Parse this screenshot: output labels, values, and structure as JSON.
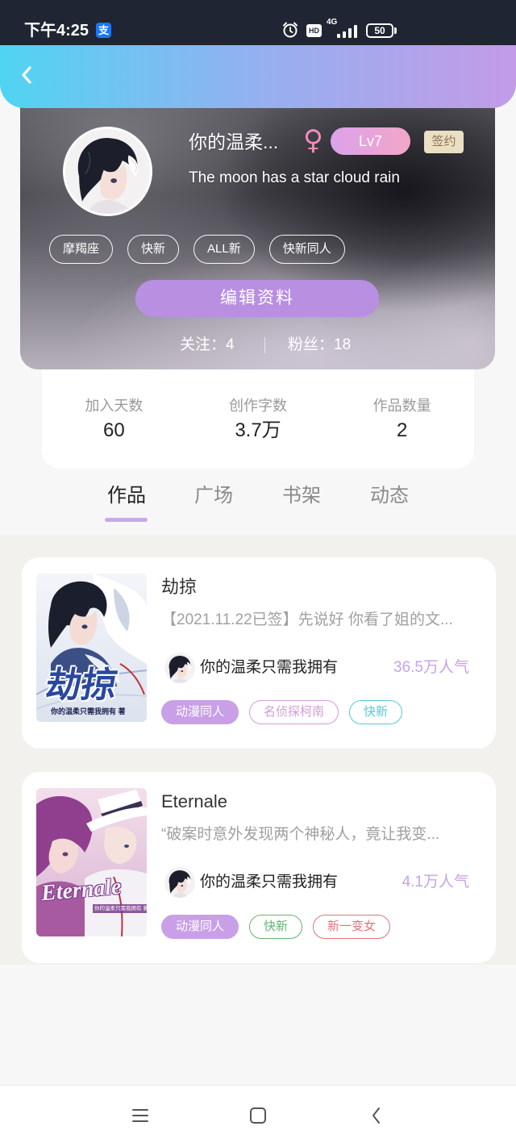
{
  "theme": {
    "status_bar_bg": "#1f2533",
    "header_start": "#50d4f2",
    "header_mid": "#95b0f0",
    "header_end": "#c39be7",
    "accent": "#b98fe2",
    "gender": "#f08cb5",
    "popularity": "#c7a3e6",
    "tab_indicator": "#c9a8ec",
    "page_bg": "#f7f7f7",
    "works_bg": "#f3f1ed"
  },
  "status_bar": {
    "time": "下午4:25",
    "app_badge": "支",
    "hd_label": "HD",
    "network_label": "4G",
    "battery_level": "50",
    "icons": [
      "alipay-icon",
      "alarm-icon",
      "hd-icon",
      "signal-icon",
      "battery-icon"
    ]
  },
  "header": {
    "back_icon": "chevron-left-icon"
  },
  "profile": {
    "name": "你的温柔...",
    "gender_symbol": "♀",
    "level": "Lv7",
    "signed_badge": "签约",
    "bio": "The moon has a star cloud rain",
    "tags": [
      "摩羯座",
      "快新",
      "ALL新",
      "快新同人"
    ],
    "edit_button": "编辑资料",
    "following": "关注：4",
    "followers": "粉丝：18"
  },
  "stats": [
    {
      "label": "加入天数",
      "value": "60"
    },
    {
      "label": "创作字数",
      "value": "3.7万"
    },
    {
      "label": "作品数量",
      "value": "2"
    }
  ],
  "tabs": [
    {
      "label": "作品",
      "active": true
    },
    {
      "label": "广场",
      "active": false
    },
    {
      "label": "书架",
      "active": false
    },
    {
      "label": "动态",
      "active": false
    }
  ],
  "works": [
    {
      "title": "劫掠",
      "cover_title": "劫掠",
      "cover_caption": "你的温柔只需我拥有 著",
      "description": "【2021.11.22已签】先说好 你看了姐的文...",
      "author": "你的温柔只需我拥有",
      "popularity": "36.5万人气",
      "tags": [
        {
          "label": "动漫同人",
          "filled": true,
          "color": "#c99fe7"
        },
        {
          "label": "名侦探柯南",
          "filled": false,
          "color": "#d39bdb"
        },
        {
          "label": "快新",
          "filled": false,
          "color": "#55cbd6"
        }
      ]
    },
    {
      "title": "Eternale",
      "cover_title": "Eternale",
      "cover_caption": "你的温柔只需我拥有 著",
      "description": "“破案时意外发现两个神秘人，竟让我变...",
      "author": "你的温柔只需我拥有",
      "popularity": "4.1万人气",
      "tags": [
        {
          "label": "动漫同人",
          "filled": true,
          "color": "#c99fe7"
        },
        {
          "label": "快新",
          "filled": false,
          "color": "#63b574"
        },
        {
          "label": "新一变女",
          "filled": false,
          "color": "#e3737c"
        }
      ]
    }
  ],
  "nav_bar": {
    "icons": [
      "menu-icon",
      "home-icon",
      "back-icon"
    ]
  }
}
